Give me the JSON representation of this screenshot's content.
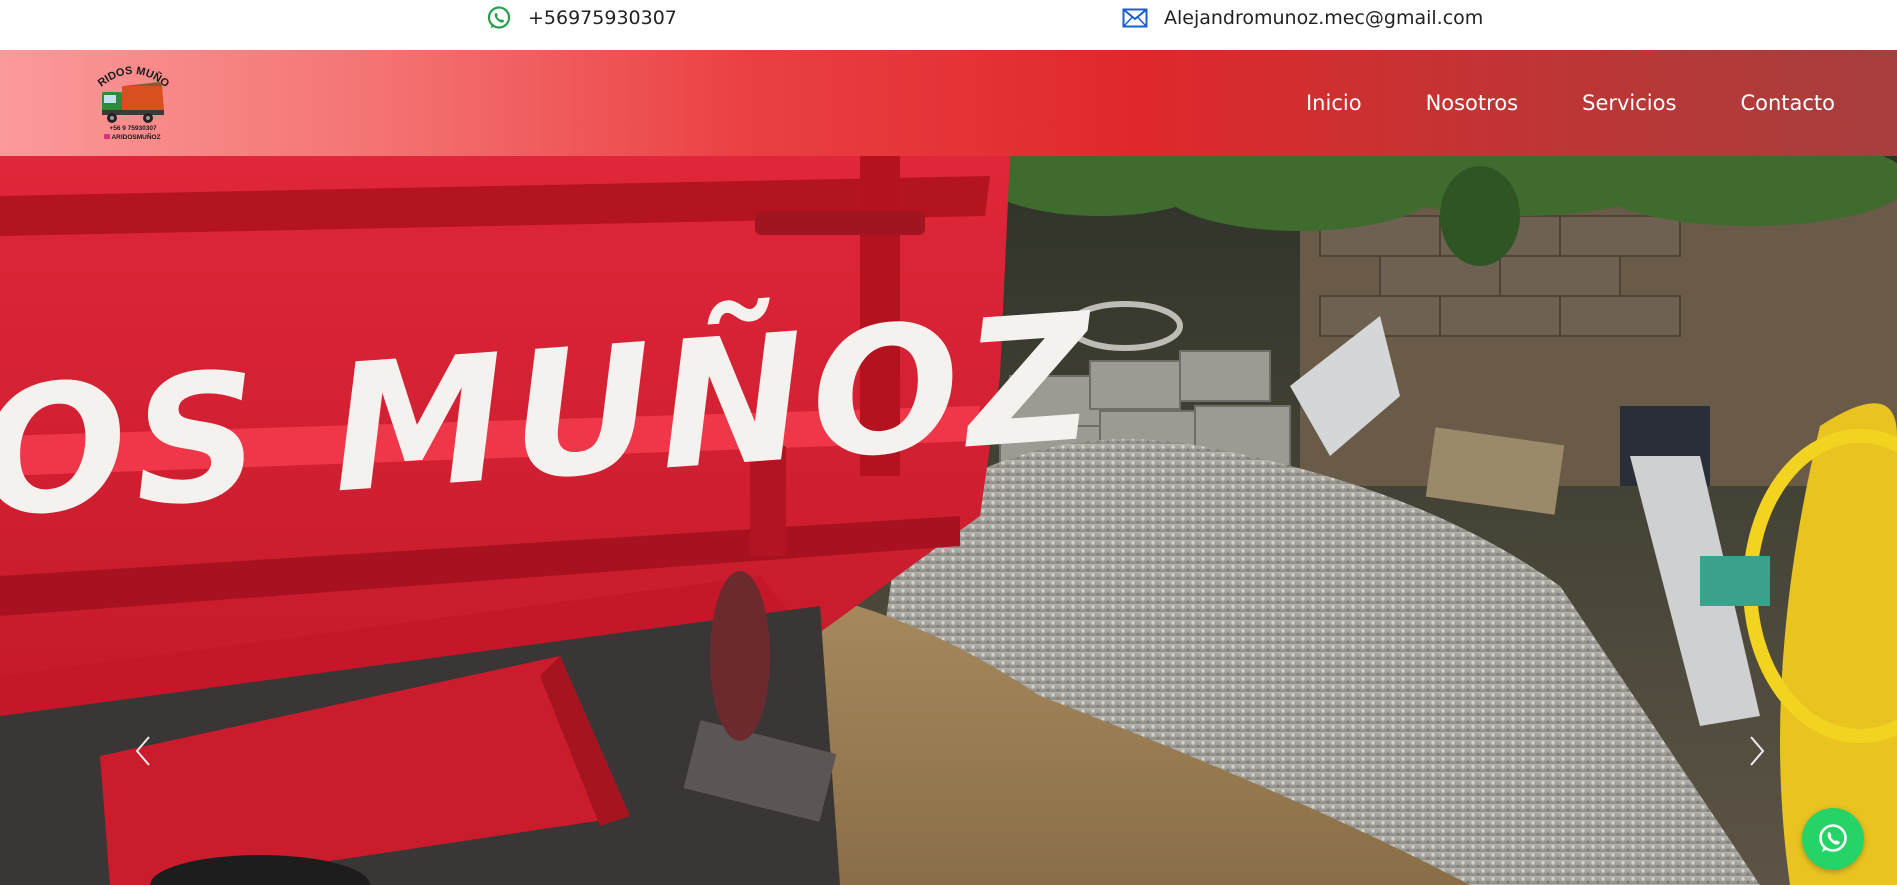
{
  "topbar": {
    "phone": "+56975930307",
    "email": "Alejandromunoz.mec@gmail.com",
    "phone_icon": "whatsapp-icon",
    "email_icon": "envelope-icon"
  },
  "logo": {
    "title": "ÁRIDOS MUÑOZ",
    "phone": "+56 9 75930307",
    "handle": "ARIDOSMUÑOZ"
  },
  "nav": {
    "items": [
      {
        "label": "Inicio"
      },
      {
        "label": "Nosotros"
      },
      {
        "label": "Servicios"
      },
      {
        "label": "Contacto"
      }
    ]
  },
  "hero": {
    "truck_text": "OS MUÑOZ",
    "prev_icon": "chevron-left-icon",
    "next_icon": "chevron-right-icon"
  },
  "floating": {
    "icon": "whatsapp-icon"
  },
  "colors": {
    "nav_gradient_start": "#fb9a9a",
    "nav_gradient_mid": "#e0282c",
    "nav_gradient_end": "#a73e3e",
    "truck_red": "#d91f2c",
    "whatsapp_green": "#25d366",
    "icon_blue": "#1a5fd1"
  }
}
